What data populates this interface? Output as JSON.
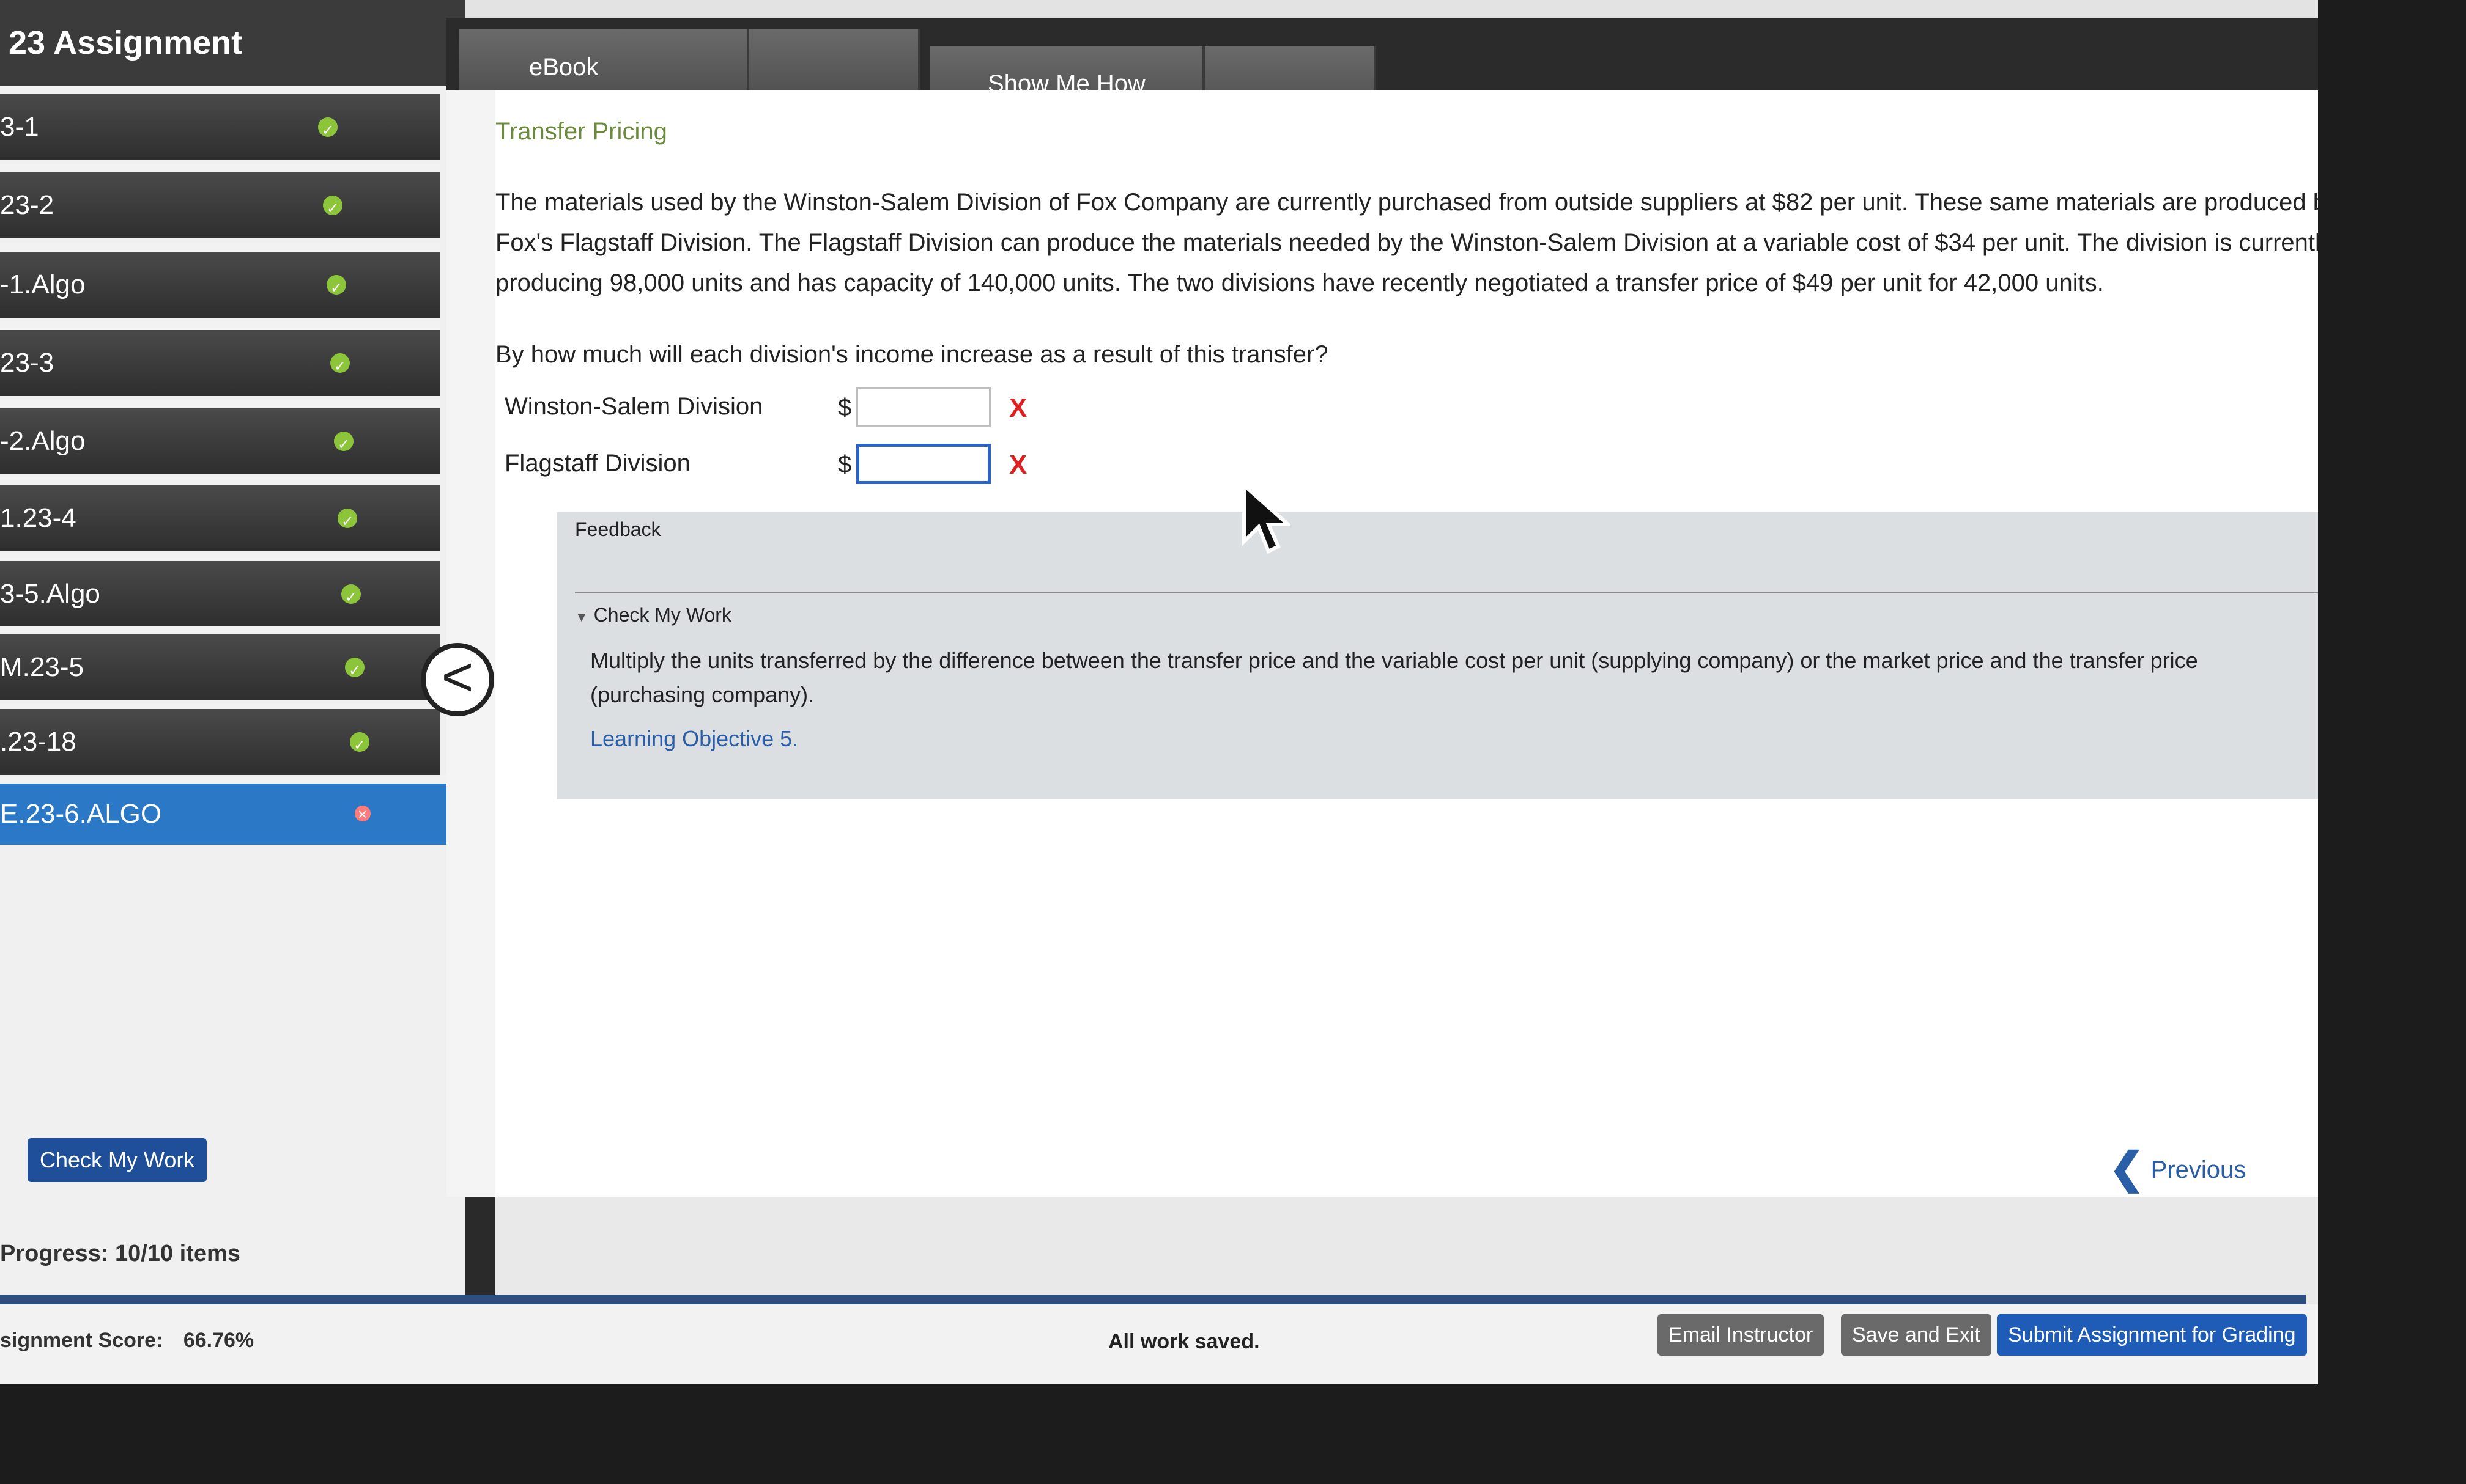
{
  "sidebar": {
    "title": "23 Assignment",
    "items": [
      {
        "label": "3-1",
        "status": "complete"
      },
      {
        "label": "23-2",
        "status": "complete"
      },
      {
        "label": "-1.Algo",
        "status": "complete"
      },
      {
        "label": "23-3",
        "status": "complete"
      },
      {
        "label": "-2.Algo",
        "status": "complete"
      },
      {
        "label": "1.23-4",
        "status": "complete"
      },
      {
        "label": "3-5.Algo",
        "status": "complete"
      },
      {
        "label": "M.23-5",
        "status": "complete"
      },
      {
        "label": ".23-18",
        "status": "complete"
      },
      {
        "label": "E.23-6.ALGO",
        "status": "incorrect",
        "active": true
      }
    ],
    "progress_label": "Progress:",
    "progress_value": "10/10 items",
    "collapse_glyph": "<"
  },
  "tabs": [
    {
      "label": "eBook"
    },
    {
      "label": "Show Me How"
    }
  ],
  "problem": {
    "section_title": "Transfer Pricing",
    "text": "The materials used by the Winston-Salem Division of Fox Company are currently purchased from outside suppliers at $82 per unit. These same materials are produced by Fox's Flagstaff Division. The Flagstaff Division can produce the materials needed by the Winston-Salem Division at a variable cost of $34 per unit. The division is currently producing 98,000 units and has capacity of 140,000 units. The two divisions have recently negotiated a transfer price of $49 per unit for 42,000 units.",
    "question": "By how much will each division's income increase as a result of this transfer?",
    "answers": [
      {
        "label": "Winston-Salem Division",
        "currency": "$",
        "value": "",
        "mark": "X"
      },
      {
        "label": "Flagstaff Division",
        "currency": "$",
        "value": "",
        "mark": "X"
      }
    ]
  },
  "feedback": {
    "heading": "Feedback",
    "check_label": "Check My Work",
    "hint": "Multiply the units transferred by the difference between the transfer price and the variable cost per unit (supplying company) or the market price and the transfer price (purchasing company).",
    "link": "Learning Objective 5."
  },
  "actions": {
    "check_my_work": "Check My Work",
    "previous": "Previous"
  },
  "footer": {
    "score_label": "signment Score:",
    "score_value": "66.76%",
    "saved_status": "All work saved.",
    "email": "Email Instructor",
    "save_exit": "Save and Exit",
    "submit": "Submit Assignment for Grading"
  },
  "colors": {
    "accent_blue": "#1f5cb8",
    "complete_green": "#8cc43a",
    "error_red": "#e02020",
    "section_title_green": "#6c8a3e"
  }
}
